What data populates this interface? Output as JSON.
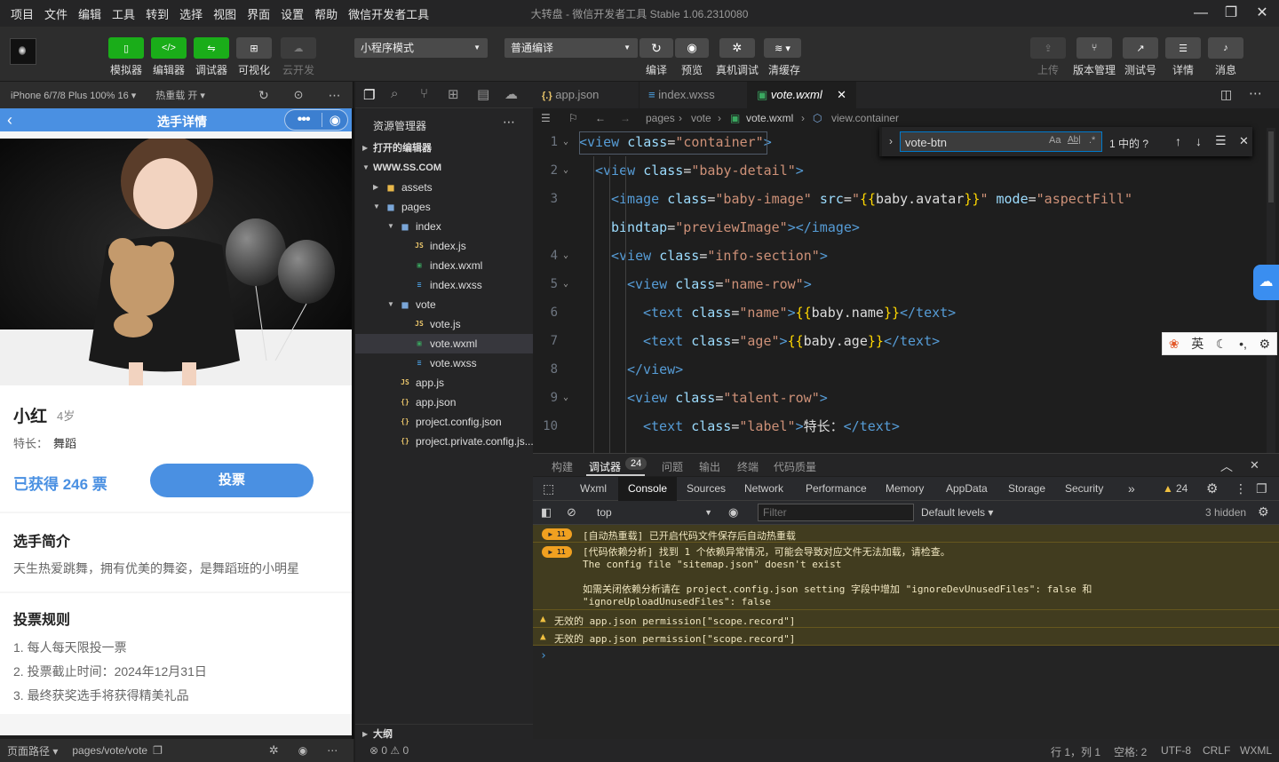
{
  "menubar": {
    "items": [
      "项目",
      "文件",
      "编辑",
      "工具",
      "转到",
      "选择",
      "视图",
      "界面",
      "设置",
      "帮助",
      "微信开发者工具"
    ],
    "title": "大转盘 - 微信开发者工具 Stable 1.06.2310080"
  },
  "toolbar": {
    "simulator": "模拟器",
    "editor": "编辑器",
    "debugger": "调试器",
    "visual": "可视化",
    "cloud": "云开发",
    "mode_select": "小程序模式",
    "compile_select": "普通编译",
    "compile": "编译",
    "preview": "预览",
    "remote_debug": "真机调试",
    "clear_cache": "清缓存",
    "upload": "上传",
    "version": "版本管理",
    "test_account": "测试号",
    "details": "详情",
    "messages": "消息"
  },
  "simulator": {
    "device": "iPhone 6/7/8 Plus 100% 16",
    "hot_reload": "热重载 开",
    "nav_title": "选手详情",
    "name": "小红",
    "age": "4岁",
    "talent_label": "特长：",
    "talent": "舞蹈",
    "votes": "已获得 246 票",
    "vote_button": "投票",
    "intro_title": "选手简介",
    "intro_text": "天生热爱跳舞，拥有优美的舞姿，是舞蹈班的小明星",
    "rules_title": "投票规则",
    "rules": [
      "1. 每人每天限投一票",
      "2. 投票截止时间：2024年12月31日",
      "3. 最终获奖选手将获得精美礼品"
    ],
    "page_path_label": "页面路径",
    "page_path": "pages/vote/vote"
  },
  "explorer": {
    "title": "资源管理器",
    "open_editors": "打开的编辑器",
    "root": "WWW.SS.COM",
    "tree": [
      {
        "name": "assets",
        "type": "folder"
      },
      {
        "name": "pages",
        "type": "folder-open"
      },
      {
        "name": "index",
        "type": "folder-open"
      },
      {
        "name": "index.js",
        "type": "js"
      },
      {
        "name": "index.wxml",
        "type": "wxml"
      },
      {
        "name": "index.wxss",
        "type": "wxss"
      },
      {
        "name": "vote",
        "type": "folder-open"
      },
      {
        "name": "vote.js",
        "type": "js"
      },
      {
        "name": "vote.wxml",
        "type": "wxml"
      },
      {
        "name": "vote.wxss",
        "type": "wxss"
      },
      {
        "name": "app.js",
        "type": "js"
      },
      {
        "name": "app.json",
        "type": "json"
      },
      {
        "name": "project.config.json",
        "type": "json"
      },
      {
        "name": "project.private.config.js...",
        "type": "json"
      }
    ],
    "outline": "大纲",
    "problems": "⊗ 0 ⚠ 0"
  },
  "editor": {
    "tabs": [
      {
        "label": "app.json",
        "icon": "{.}"
      },
      {
        "label": "index.wxss",
        "icon": "≡"
      },
      {
        "label": "vote.wxml",
        "icon": "wxml"
      }
    ],
    "breadcrumb": [
      "pages",
      "vote",
      "vote.wxml",
      "view.container"
    ],
    "find_text": "vote-btn",
    "find_result": "1 中的 ?",
    "line_numbers": [
      "1",
      "2",
      "3",
      "",
      "4",
      "5",
      "6",
      "7",
      "8",
      "9",
      "10"
    ],
    "lines": [
      [
        [
          "tg",
          "<view "
        ],
        [
          "at",
          "class"
        ],
        [
          "tx",
          "="
        ],
        [
          "sv",
          "\"container\""
        ],
        [
          "tg",
          ">"
        ]
      ],
      [
        [
          "tg",
          "<view "
        ],
        [
          "at",
          "class"
        ],
        [
          "tx",
          "="
        ],
        [
          "sv",
          "\"baby-detail\""
        ],
        [
          "tg",
          ">"
        ]
      ],
      [
        [
          "tg",
          "<image "
        ],
        [
          "at",
          "class"
        ],
        [
          "tx",
          "="
        ],
        [
          "sv",
          "\"baby-image\" "
        ],
        [
          "at",
          "src"
        ],
        [
          "tx",
          "="
        ],
        [
          "sv",
          "\""
        ],
        [
          "br",
          "{{"
        ],
        [
          "tx",
          "baby.avatar"
        ],
        [
          "br",
          "}}"
        ],
        [
          "sv",
          "\" "
        ],
        [
          "at",
          "mode"
        ],
        [
          "tx",
          "="
        ],
        [
          "sv",
          "\"aspectFill\""
        ]
      ],
      [
        [
          "at",
          "bindtap"
        ],
        [
          "tx",
          "="
        ],
        [
          "sv",
          "\"previewImage\""
        ],
        [
          "tg",
          "></image>"
        ]
      ],
      [
        [
          "tg",
          "<view "
        ],
        [
          "at",
          "class"
        ],
        [
          "tx",
          "="
        ],
        [
          "sv",
          "\"info-section\""
        ],
        [
          "tg",
          ">"
        ]
      ],
      [
        [
          "tg",
          "<view "
        ],
        [
          "at",
          "class"
        ],
        [
          "tx",
          "="
        ],
        [
          "sv",
          "\"name-row\""
        ],
        [
          "tg",
          ">"
        ]
      ],
      [
        [
          "tg",
          "<text "
        ],
        [
          "at",
          "class"
        ],
        [
          "tx",
          "="
        ],
        [
          "sv",
          "\"name\""
        ],
        [
          "tg",
          ">"
        ],
        [
          "br",
          "{{"
        ],
        [
          "tx",
          "baby.name"
        ],
        [
          "br",
          "}}"
        ],
        [
          "tg",
          "</text>"
        ]
      ],
      [
        [
          "tg",
          "<text "
        ],
        [
          "at",
          "class"
        ],
        [
          "tx",
          "="
        ],
        [
          "sv",
          "\"age\""
        ],
        [
          "tg",
          ">"
        ],
        [
          "br",
          "{{"
        ],
        [
          "tx",
          "baby.age"
        ],
        [
          "br",
          "}}"
        ],
        [
          "tg",
          "</text>"
        ]
      ],
      [
        [
          "tg",
          "</view>"
        ]
      ],
      [
        [
          "tg",
          "<view "
        ],
        [
          "at",
          "class"
        ],
        [
          "tx",
          "="
        ],
        [
          "sv",
          "\"talent-row\""
        ],
        [
          "tg",
          ">"
        ]
      ],
      [
        [
          "tg",
          "<text "
        ],
        [
          "at",
          "class"
        ],
        [
          "tx",
          "="
        ],
        [
          "sv",
          "\"label\""
        ],
        [
          "tg",
          ">"
        ],
        [
          "tx",
          "特长："
        ],
        [
          "tg",
          "</text>"
        ]
      ]
    ]
  },
  "panel": {
    "tabs": [
      "构建",
      "调试器",
      "问题",
      "输出",
      "终端",
      "代码质量"
    ],
    "debugger_count": "24",
    "devtools_tabs": [
      "Wxml",
      "Console",
      "Sources",
      "Network",
      "Performance",
      "Memory",
      "AppData",
      "Storage",
      "Security"
    ],
    "warning_count": "24",
    "context": "top",
    "filter_placeholder": "Filter",
    "levels": "Default levels",
    "hidden": "3 hidden",
    "messages": [
      {
        "badge": "11",
        "text": "[自动热重载] 已开启代码文件保存后自动热重载"
      },
      {
        "badge": "11",
        "text": "[代码依赖分析] 找到 1 个依赖异常情况，可能会导致对应文件无法加载，请检查。\nThe config file \"sitemap.json\" doesn't exist\n\n如需关闭依赖分析请在 project.config.json setting 字段中增加 \"ignoreDevUnusedFiles\": false 和\n\"ignoreUploadUnusedFiles\": false"
      },
      {
        "badge": "",
        "text": "无效的 app.json permission[\"scope.record\"]"
      },
      {
        "badge": "",
        "text": "无效的 app.json permission[\"scope.record\"]"
      }
    ]
  },
  "statusbar": {
    "position": "行 1，列 1",
    "spaces": "空格: 2",
    "encoding": "UTF-8",
    "eol": "CRLF",
    "language": "WXML"
  },
  "ime": {
    "lang": "英"
  },
  "colors": {
    "accent": "#4a90e2",
    "toolbar_green": "#1aad19",
    "editor_bg": "#1e1e1e"
  }
}
